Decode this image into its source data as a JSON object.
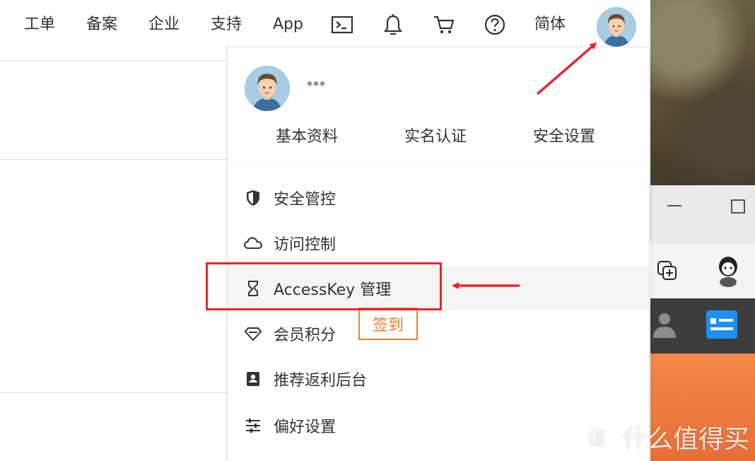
{
  "topbar": {
    "nav": [
      "工单",
      "备案",
      "企业",
      "支持",
      "App"
    ],
    "icons": [
      "terminal-icon",
      "bell-icon",
      "cart-icon",
      "help-icon"
    ],
    "language": "简体"
  },
  "dropdown": {
    "username": "***",
    "links": [
      "基本资料",
      "实名认证",
      "安全设置"
    ],
    "menu": [
      {
        "label": "安全管控",
        "icon": "shield-icon"
      },
      {
        "label": "访问控制",
        "icon": "cloud-icon"
      },
      {
        "label": "AccessKey 管理",
        "icon": "key-hourglass-icon",
        "highlighted": true
      },
      {
        "label": "会员积分",
        "icon": "diamond-icon",
        "badge": "签到"
      },
      {
        "label": "推荐返利后台",
        "icon": "portrait-icon"
      },
      {
        "label": "偏好设置",
        "icon": "sliders-icon"
      }
    ]
  },
  "watermark": {
    "text": "什么值得买",
    "logo": "值"
  },
  "colors": {
    "accent_orange": "#f07f2c",
    "annotation_red": "#e5282a",
    "text": "#333333"
  }
}
